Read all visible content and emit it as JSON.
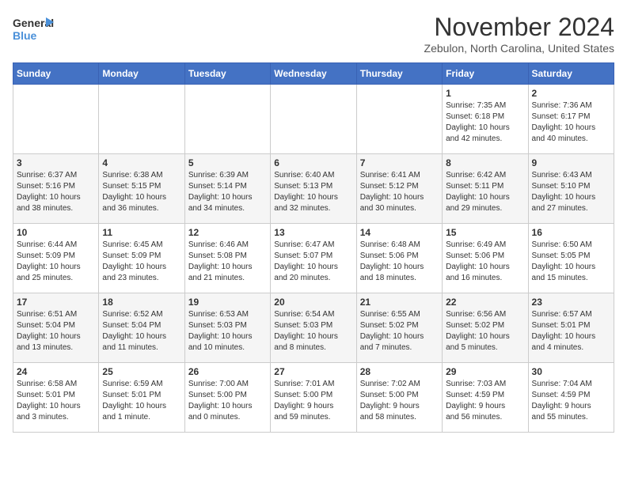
{
  "header": {
    "logo_line1": "General",
    "logo_line2": "Blue",
    "month_title": "November 2024",
    "location": "Zebulon, North Carolina, United States"
  },
  "days_of_week": [
    "Sunday",
    "Monday",
    "Tuesday",
    "Wednesday",
    "Thursday",
    "Friday",
    "Saturday"
  ],
  "weeks": [
    [
      {
        "day": "",
        "info": ""
      },
      {
        "day": "",
        "info": ""
      },
      {
        "day": "",
        "info": ""
      },
      {
        "day": "",
        "info": ""
      },
      {
        "day": "",
        "info": ""
      },
      {
        "day": "1",
        "info": "Sunrise: 7:35 AM\nSunset: 6:18 PM\nDaylight: 10 hours\nand 42 minutes."
      },
      {
        "day": "2",
        "info": "Sunrise: 7:36 AM\nSunset: 6:17 PM\nDaylight: 10 hours\nand 40 minutes."
      }
    ],
    [
      {
        "day": "3",
        "info": "Sunrise: 6:37 AM\nSunset: 5:16 PM\nDaylight: 10 hours\nand 38 minutes."
      },
      {
        "day": "4",
        "info": "Sunrise: 6:38 AM\nSunset: 5:15 PM\nDaylight: 10 hours\nand 36 minutes."
      },
      {
        "day": "5",
        "info": "Sunrise: 6:39 AM\nSunset: 5:14 PM\nDaylight: 10 hours\nand 34 minutes."
      },
      {
        "day": "6",
        "info": "Sunrise: 6:40 AM\nSunset: 5:13 PM\nDaylight: 10 hours\nand 32 minutes."
      },
      {
        "day": "7",
        "info": "Sunrise: 6:41 AM\nSunset: 5:12 PM\nDaylight: 10 hours\nand 30 minutes."
      },
      {
        "day": "8",
        "info": "Sunrise: 6:42 AM\nSunset: 5:11 PM\nDaylight: 10 hours\nand 29 minutes."
      },
      {
        "day": "9",
        "info": "Sunrise: 6:43 AM\nSunset: 5:10 PM\nDaylight: 10 hours\nand 27 minutes."
      }
    ],
    [
      {
        "day": "10",
        "info": "Sunrise: 6:44 AM\nSunset: 5:09 PM\nDaylight: 10 hours\nand 25 minutes."
      },
      {
        "day": "11",
        "info": "Sunrise: 6:45 AM\nSunset: 5:09 PM\nDaylight: 10 hours\nand 23 minutes."
      },
      {
        "day": "12",
        "info": "Sunrise: 6:46 AM\nSunset: 5:08 PM\nDaylight: 10 hours\nand 21 minutes."
      },
      {
        "day": "13",
        "info": "Sunrise: 6:47 AM\nSunset: 5:07 PM\nDaylight: 10 hours\nand 20 minutes."
      },
      {
        "day": "14",
        "info": "Sunrise: 6:48 AM\nSunset: 5:06 PM\nDaylight: 10 hours\nand 18 minutes."
      },
      {
        "day": "15",
        "info": "Sunrise: 6:49 AM\nSunset: 5:06 PM\nDaylight: 10 hours\nand 16 minutes."
      },
      {
        "day": "16",
        "info": "Sunrise: 6:50 AM\nSunset: 5:05 PM\nDaylight: 10 hours\nand 15 minutes."
      }
    ],
    [
      {
        "day": "17",
        "info": "Sunrise: 6:51 AM\nSunset: 5:04 PM\nDaylight: 10 hours\nand 13 minutes."
      },
      {
        "day": "18",
        "info": "Sunrise: 6:52 AM\nSunset: 5:04 PM\nDaylight: 10 hours\nand 11 minutes."
      },
      {
        "day": "19",
        "info": "Sunrise: 6:53 AM\nSunset: 5:03 PM\nDaylight: 10 hours\nand 10 minutes."
      },
      {
        "day": "20",
        "info": "Sunrise: 6:54 AM\nSunset: 5:03 PM\nDaylight: 10 hours\nand 8 minutes."
      },
      {
        "day": "21",
        "info": "Sunrise: 6:55 AM\nSunset: 5:02 PM\nDaylight: 10 hours\nand 7 minutes."
      },
      {
        "day": "22",
        "info": "Sunrise: 6:56 AM\nSunset: 5:02 PM\nDaylight: 10 hours\nand 5 minutes."
      },
      {
        "day": "23",
        "info": "Sunrise: 6:57 AM\nSunset: 5:01 PM\nDaylight: 10 hours\nand 4 minutes."
      }
    ],
    [
      {
        "day": "24",
        "info": "Sunrise: 6:58 AM\nSunset: 5:01 PM\nDaylight: 10 hours\nand 3 minutes."
      },
      {
        "day": "25",
        "info": "Sunrise: 6:59 AM\nSunset: 5:01 PM\nDaylight: 10 hours\nand 1 minute."
      },
      {
        "day": "26",
        "info": "Sunrise: 7:00 AM\nSunset: 5:00 PM\nDaylight: 10 hours\nand 0 minutes."
      },
      {
        "day": "27",
        "info": "Sunrise: 7:01 AM\nSunset: 5:00 PM\nDaylight: 9 hours\nand 59 minutes."
      },
      {
        "day": "28",
        "info": "Sunrise: 7:02 AM\nSunset: 5:00 PM\nDaylight: 9 hours\nand 58 minutes."
      },
      {
        "day": "29",
        "info": "Sunrise: 7:03 AM\nSunset: 4:59 PM\nDaylight: 9 hours\nand 56 minutes."
      },
      {
        "day": "30",
        "info": "Sunrise: 7:04 AM\nSunset: 4:59 PM\nDaylight: 9 hours\nand 55 minutes."
      }
    ]
  ]
}
